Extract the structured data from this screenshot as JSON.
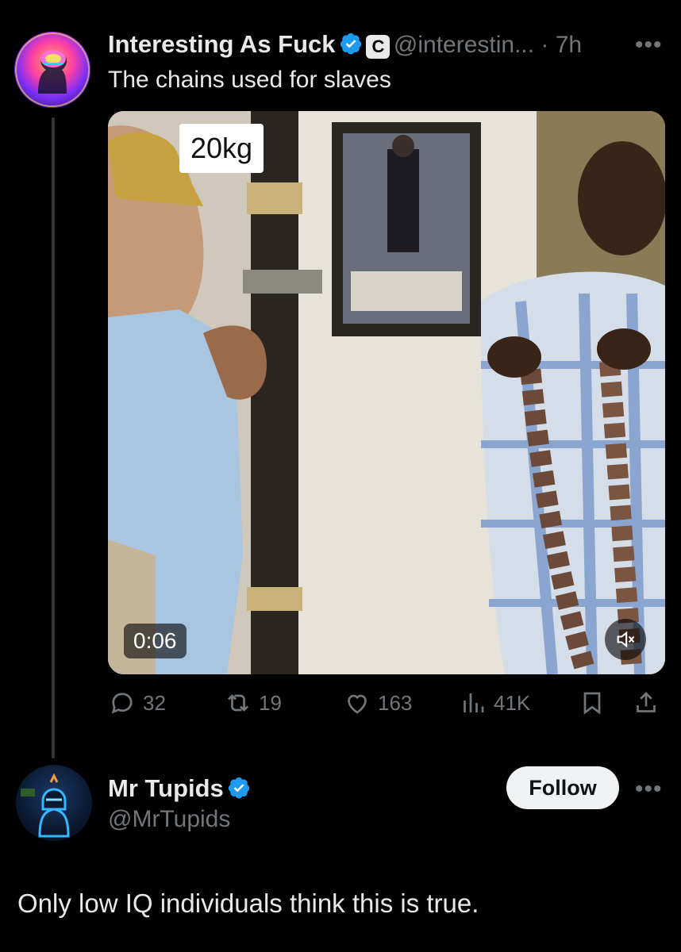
{
  "tweet": {
    "author_name": "Interesting As Fuck",
    "badge_letter": "C",
    "handle_time": "@interestin... · 7h",
    "text": "The chains used for slaves",
    "video": {
      "overlay_caption": "20kg",
      "timestamp": "0:06"
    },
    "actions": {
      "replies": "32",
      "reposts": "19",
      "likes": "163",
      "views": "41K"
    }
  },
  "reply": {
    "author_name": "Mr Tupids",
    "handle": "@MrTupids",
    "follow_label": "Follow",
    "text": "Only low IQ individuals think this is true."
  },
  "colors": {
    "background": "#000000",
    "verified_blue": "#1d9bf0",
    "muted": "#71767b",
    "text": "#e7e9ea"
  }
}
